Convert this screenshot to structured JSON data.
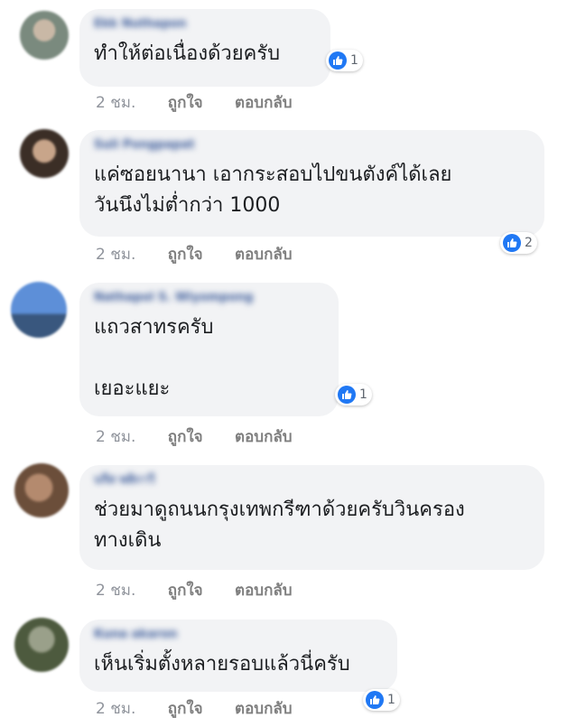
{
  "comments": [
    {
      "author": "Ekk Nuthapon",
      "text": "ทำให้ต่อเนื่องด้วยครับ",
      "time": "2 ชม.",
      "like_label": "ถูกใจ",
      "reply_label": "ตอบกลับ",
      "reactions": "1",
      "avatar_color": "#7a8a7e"
    },
    {
      "author": "Suli Pongpapat",
      "text": "แค่ซอยนานา เอากระสอบไปขนตังค์ได้เลย\nวันนึงไม่ต่ำกว่า 1000",
      "time": "2 ชม.",
      "like_label": "ถูกใจ",
      "reply_label": "ตอบกลับ",
      "reactions": "2",
      "avatar_color": "#5c4a3e"
    },
    {
      "author": "Nathapol S. Wiyompong",
      "text": "แถวสาทรครับ\n\nเยอะแยะ",
      "time": "2 ชม.",
      "like_label": "ถูกใจ",
      "reply_label": "ตอบกลับ",
      "reactions": "1",
      "avatar_color": "#3f6fb5"
    },
    {
      "author": "นรีส พลิกาวี",
      "text": "ช่วยมาดูถนนกรุงเทพกรีฑาด้วยครับวินครอง\nทางเดิน",
      "time": "2 ชม.",
      "like_label": "ถูกใจ",
      "reply_label": "ตอบกลับ",
      "reactions": "",
      "avatar_color": "#8a6a55"
    },
    {
      "author": "Kuna akaron",
      "text": "เห็นเริ่มตั้งหลายรอบแล้วนี่ครับ",
      "time": "2 ชม.",
      "like_label": "ถูกใจ",
      "reply_label": "ตอบกลับ",
      "reactions": "1",
      "avatar_color": "#4d5a3e"
    }
  ],
  "colors": {
    "bubble_bg": "#f2f3f5",
    "author_link": "#385898",
    "like_blue": "#2078f4",
    "meta_gray": "#90949c"
  },
  "icons": {
    "reaction": "thumbs-up-icon"
  }
}
